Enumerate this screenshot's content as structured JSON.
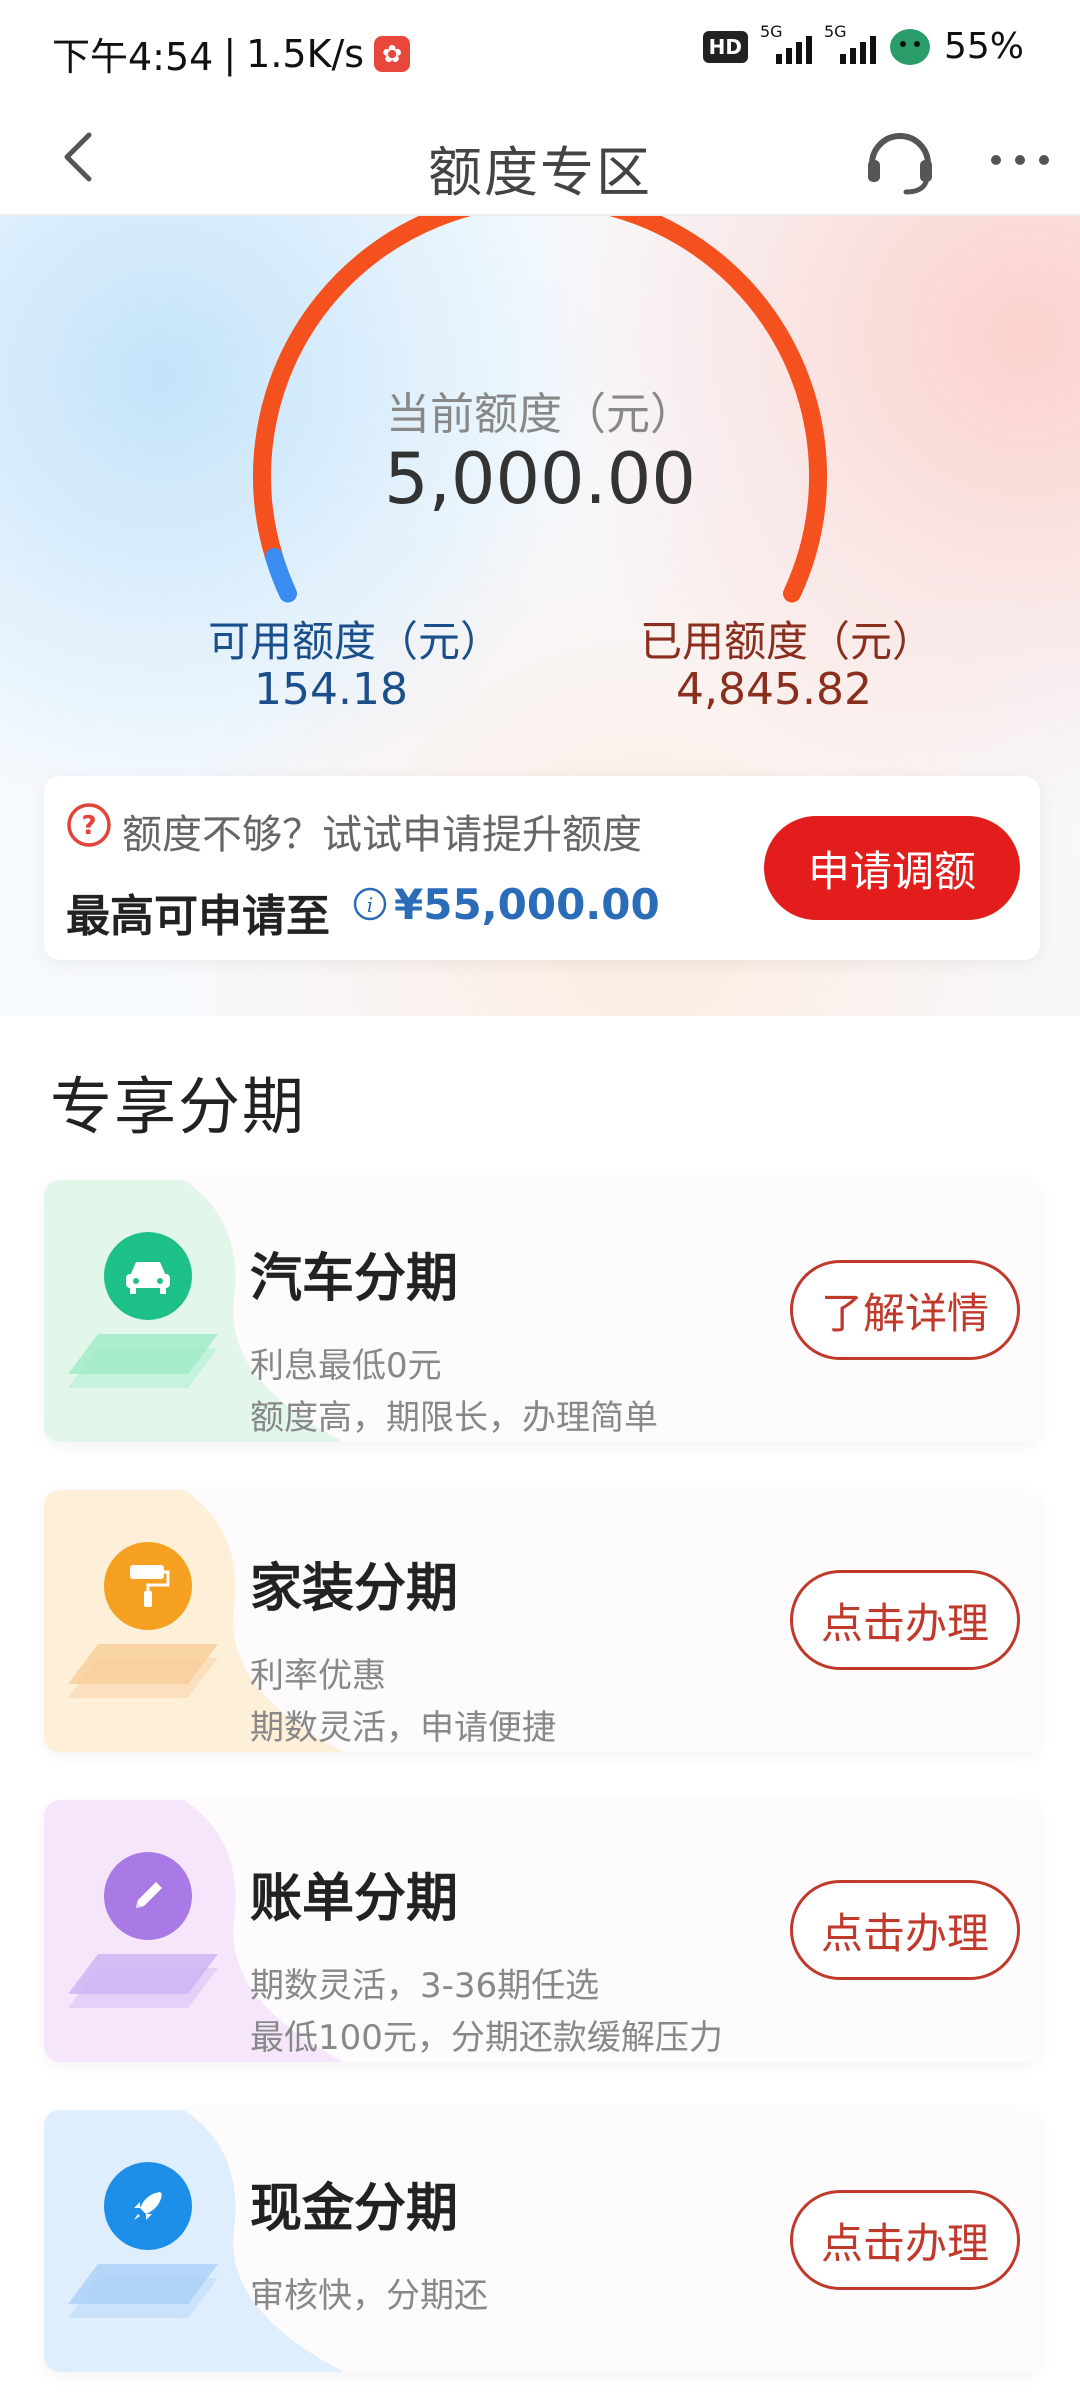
{
  "status_bar": {
    "time": "下午4:54",
    "net_speed": "1.5K/s",
    "hd_badge": "HD",
    "sig1_label": "5G",
    "sig2_label": "5G",
    "battery": "55%"
  },
  "nav": {
    "title": "额度专区"
  },
  "limit": {
    "current_label": "当前额度（元）",
    "current_value": "5,000.00",
    "available_label": "可用额度（元）",
    "available_value": "154.18",
    "used_label": "已用额度（元）",
    "used_value": "4,845.82",
    "used_fraction": 0.969
  },
  "raise": {
    "hint": "额度不够？试试申请提升额度",
    "max_label": "最高可申请至",
    "max_value": "¥55,000.00",
    "button": "申请调额"
  },
  "section": {
    "title": "专享分期"
  },
  "installments": [
    {
      "title": "汽车分期",
      "line1": "利息最低0元",
      "line2": "额度高，期限长，办理简单",
      "button": "了解详情",
      "icon": "car-icon",
      "color": "#1ec08a"
    },
    {
      "title": "家装分期",
      "line1": "利率优惠",
      "line2": "期数灵活，申请便捷",
      "button": "点击办理",
      "icon": "paint-roller-icon",
      "color": "#f5a020"
    },
    {
      "title": "账单分期",
      "line1": "期数灵活，3-36期任选",
      "line2": "最低100元，分期还款缓解压力",
      "button": "点击办理",
      "icon": "pen-icon",
      "color": "#a97ae6"
    },
    {
      "title": "现金分期",
      "line1": "审核快，分期还",
      "line2": "",
      "button": "点击办理",
      "icon": "rocket-icon",
      "color": "#1e8fe8"
    }
  ],
  "colors": {
    "accent_red": "#e31c1c",
    "gauge_orange": "#f4511e",
    "gauge_blue": "#3b8cf0",
    "available_blue": "#1b4f8c",
    "used_brown": "#8a2e1e",
    "max_value_blue": "#2b6cb8"
  }
}
